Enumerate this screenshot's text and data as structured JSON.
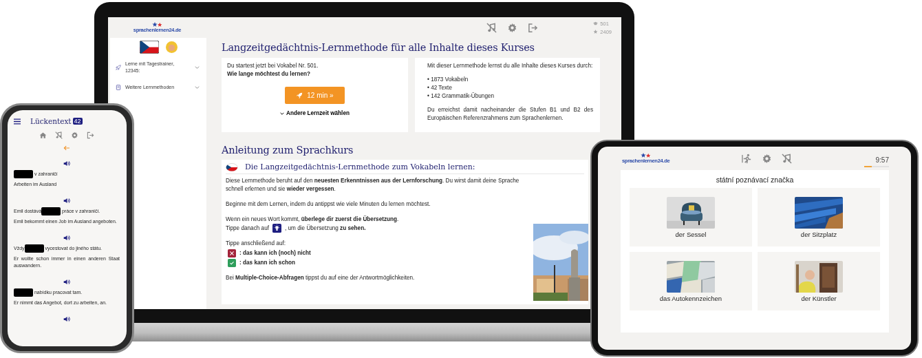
{
  "laptop": {
    "logo": "sprachenlernen24.de",
    "stats": [
      {
        "kind": "cap",
        "value": "501"
      },
      {
        "kind": "star",
        "value": "2409"
      }
    ],
    "sidebar": {
      "items": [
        {
          "kind": "rocket",
          "label": "Lerne mit Tagestrainer, 12345:",
          "expanded": false
        },
        {
          "kind": "book",
          "label": "Weitere Lernmethoden",
          "expanded": false
        }
      ]
    },
    "heading": "Langzeitgedächtnis-Lernmethode für alle Inhalte dieses Kurses",
    "start_card": {
      "line": "Du startest jetzt bei Vokabel Nr. 501.",
      "question": "Wie lange möchtest du lernen?",
      "button": "12 min »",
      "other_time": "Andere Lernzeit wählen"
    },
    "info_card": {
      "intro": "Mit dieser Lernmethode lernst du alle Inhalte dieses Kurses durch:",
      "items": [
        "• 1873 Vokabeln",
        "• 42 Texte",
        "• 142 Grammatik-Übungen"
      ],
      "outro": "Du erreichst damit nacheinander die Stufen B1 und B2 des Europäischen Referenzrahmens zum Sprachenlernen."
    },
    "guide_heading": "Anleitung zum Sprachkurs",
    "guide": {
      "title": "Die Langzeitgedächtnis-Lernmethode zum Vokabeln lernen:",
      "blocks": [
        {
          "lines": [
            {
              "kind": "text",
              "text": "Diese Lernmethode beruht auf den **neuesten Erkenntnissen aus der Lernforschung**. Du wirst damit deine Sprache schnell erlernen und sie **wieder vergessen**."
            }
          ]
        },
        {
          "lines": [
            {
              "kind": "text",
              "text": "Beginne mit dem Lernen, indem du antippst wie viele Minuten du lernen möchtest."
            }
          ]
        },
        {
          "lines": [
            {
              "kind": "text",
              "text": "Wenn ein neues Wort kommt, **überlege dir zuerst die Übersetzung**."
            },
            {
              "kind": "bulb",
              "before": "Tippe danach auf",
              "after": ", um die Übersetzung **zu sehen.**"
            }
          ]
        },
        {
          "lines": [
            {
              "kind": "text",
              "text": "Tippe anschließend auf:"
            },
            {
              "kind": "no",
              "text": ": das kann ich (noch) nicht"
            },
            {
              "kind": "yes",
              "text": ": das kann ich schon"
            }
          ]
        },
        {
          "lines": [
            {
              "kind": "text",
              "text": "Bei **Multiple-Choice-Abfragen** tippst du auf eine der Antwortmöglichkeiten."
            }
          ]
        }
      ]
    }
  },
  "phone": {
    "title": "Lückentext",
    "badge": "42",
    "items": [
      {
        "after": "v zahraničí",
        "translation": "Arbeiten im Ausland"
      },
      {
        "before": "Emil dostává",
        "after": "práce v zahraničí.",
        "translation": "Emil bekommt einen Job im Ausland angeboten."
      },
      {
        "before": "Vždy",
        "after": "vycestovat do jiného státu.",
        "translation": "Er wollte schon immer in einen anderen Staat auswandern."
      },
      {
        "after": "nabídku pracovat tam.",
        "translation": "Er nimmt das Angebot, dort zu arbeiten, an."
      }
    ]
  },
  "tablet": {
    "logo": "sprachenlernen24.de",
    "timer": "9:57",
    "level": 0.3,
    "prompt": "státní poznávací značka",
    "options": [
      {
        "label": "der Sessel"
      },
      {
        "label": "der Sitzplatz"
      },
      {
        "label": "das Autokennzeichen"
      },
      {
        "label": "der Künstler"
      }
    ]
  }
}
